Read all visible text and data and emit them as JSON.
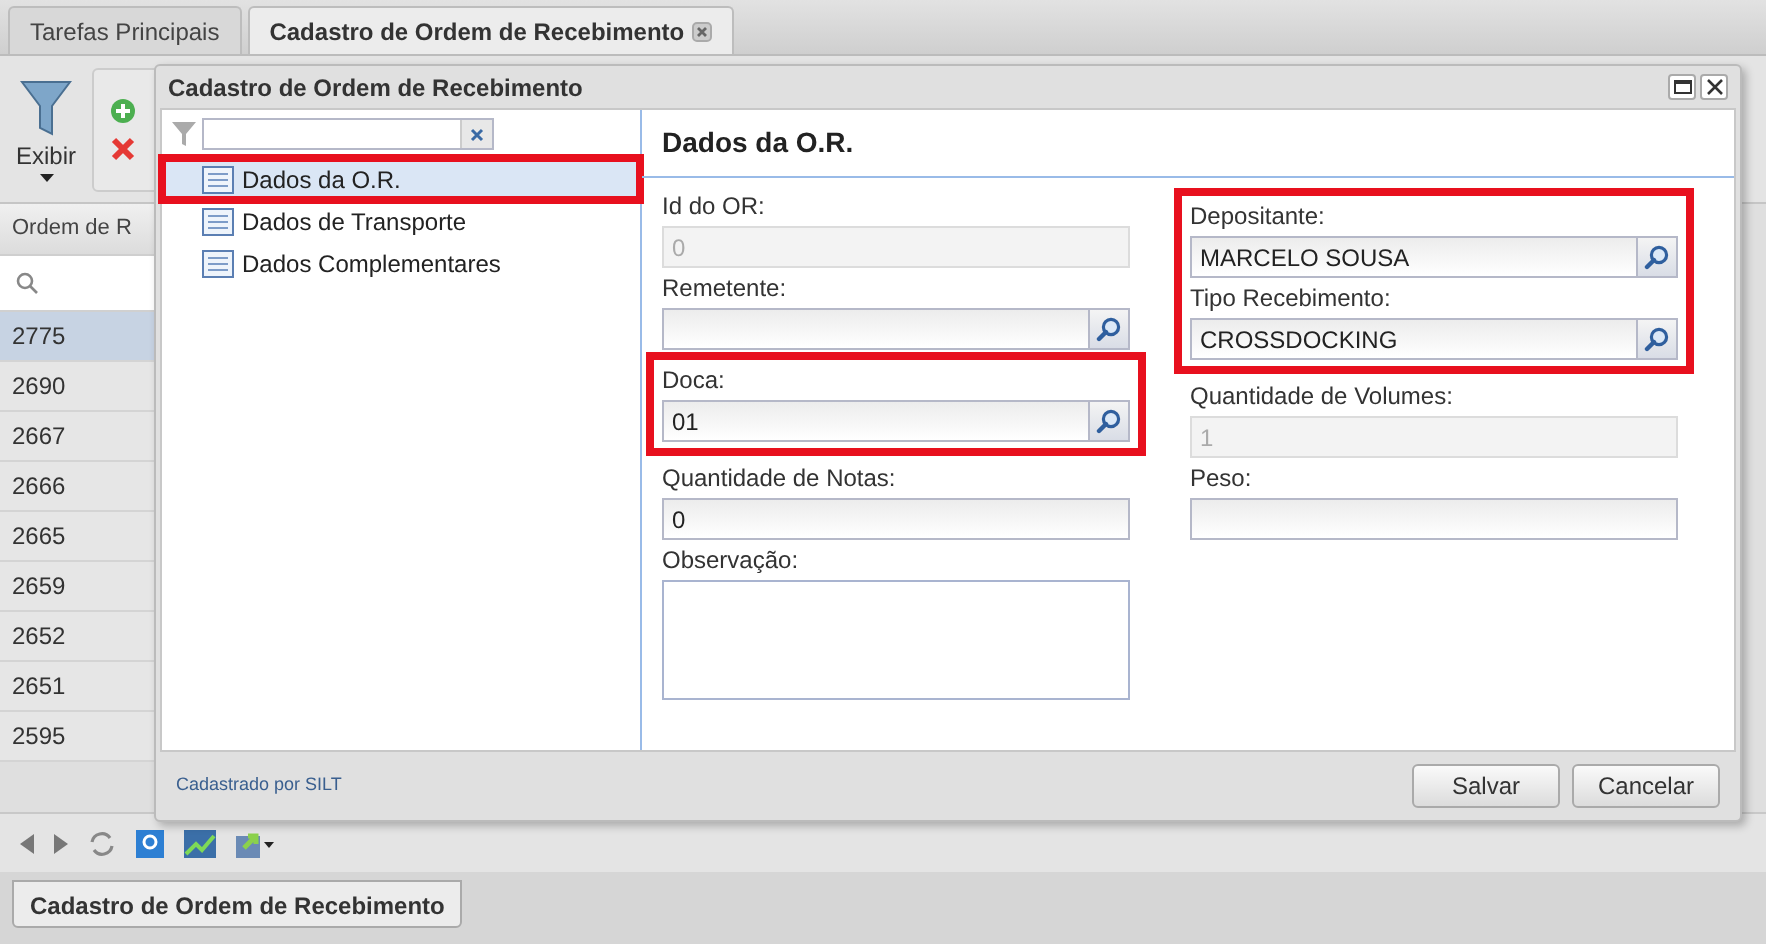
{
  "tabs": [
    {
      "label": "Tarefas Principais",
      "selected": false,
      "closable": false
    },
    {
      "label": "Cadastro de Ordem de Recebimento",
      "selected": true,
      "closable": true
    }
  ],
  "toolbar": {
    "view_button": "Exibir",
    "actions": [
      {
        "kind": "add"
      },
      {
        "kind": "delete"
      }
    ]
  },
  "grid": {
    "column_1": "Ordem de R",
    "rows": [
      {
        "value": "2775",
        "selected": true
      },
      {
        "value": "2690",
        "selected": false
      },
      {
        "value": "2667",
        "selected": false
      },
      {
        "value": "2666",
        "selected": false
      },
      {
        "value": "2665",
        "selected": false
      },
      {
        "value": "2659",
        "selected": false
      },
      {
        "value": "2652",
        "selected": false
      },
      {
        "value": "2651",
        "selected": false
      },
      {
        "value": "2595",
        "selected": false
      }
    ]
  },
  "taskbar": {
    "label": "Cadastro de Ordem de Recebimento"
  },
  "dialog": {
    "title": "Cadastro de Ordem de Recebimento",
    "tree": [
      {
        "label": "Dados da O.R.",
        "selected": true,
        "highlighted": true
      },
      {
        "label": "Dados de Transporte",
        "selected": false,
        "highlighted": false
      },
      {
        "label": "Dados Complementares",
        "selected": false,
        "highlighted": false
      }
    ],
    "section_title": "Dados da O.R.",
    "left_fields": [
      {
        "label": "Id do OR:",
        "kind": "text",
        "value": "0",
        "disabled": true,
        "highlighted": false
      },
      {
        "label": "Remetente:",
        "kind": "lookup",
        "disabled": false,
        "highlighted": false
      },
      {
        "label": "Doca:",
        "kind": "lookup",
        "value": "01",
        "disabled": false,
        "highlighted": true
      },
      {
        "label": "Quantidade de Notas:",
        "kind": "text",
        "value": "0",
        "disabled": false,
        "highlighted": false
      },
      {
        "label": "Observação:",
        "kind": "textarea",
        "disabled": false,
        "highlighted": false
      }
    ],
    "right_fields": [
      {
        "label": "Depositante:",
        "kind": "lookup",
        "value": "MARCELO SOUSA",
        "disabled": false,
        "highlighted": true
      },
      {
        "label": "Tipo Recebimento:",
        "kind": "lookup",
        "value": "CROSSDOCKING",
        "disabled": false,
        "highlighted": true
      },
      {
        "label": "Quantidade de Volumes:",
        "kind": "text",
        "value": "1",
        "disabled": true,
        "highlighted": false
      },
      {
        "label": "Peso:",
        "kind": "text",
        "disabled": false,
        "highlighted": false
      }
    ],
    "footer_note": "Cadastrado por SILT",
    "buttons": [
      "Salvar",
      "Cancelar"
    ]
  }
}
